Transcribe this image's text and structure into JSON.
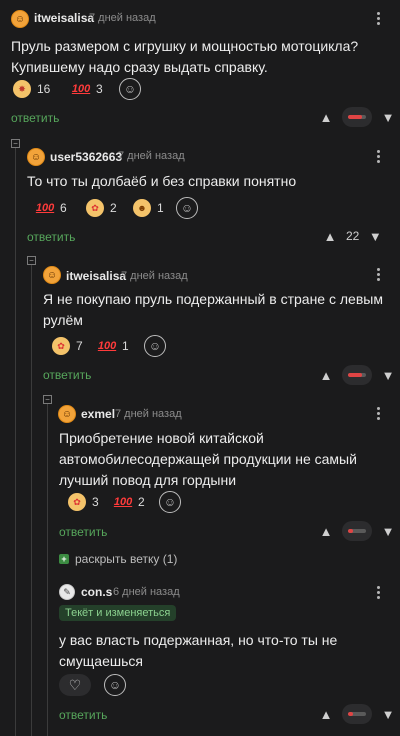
{
  "comments": [
    {
      "username": "itweisalisa",
      "time": "7 дней назад",
      "text": "Пруль размером с игрушку и мощностью мотоцикла? Купившему надо сразу выдать справку.",
      "reactions": [
        {
          "icon": "exploding-face-icon",
          "count": "16"
        },
        {
          "icon": "hundred-icon",
          "count": "3"
        }
      ],
      "reply_label": "ответить",
      "vote_ratio": 0.75
    },
    {
      "username": "user5362663",
      "time": "7 дней назад",
      "text": "То что ты долбаёб и без справки понятно",
      "reactions": [
        {
          "icon": "hundred-icon",
          "count": "6"
        },
        {
          "icon": "clown-face-icon",
          "count": "2"
        },
        {
          "icon": "smiling-face-icon",
          "count": "1"
        }
      ],
      "reply_label": "ответить",
      "vote_count": "22"
    },
    {
      "username": "itweisalisa",
      "time": "7 дней назад",
      "text": "Я не покупаю пруль подержанный в стране с левым рулём",
      "reactions": [
        {
          "icon": "clown-face-icon",
          "count": "7"
        },
        {
          "icon": "hundred-icon",
          "count": "1"
        }
      ],
      "reply_label": "ответить",
      "vote_ratio": 0.75
    },
    {
      "username": "exmel",
      "time": "7 дней назад",
      "text": "Приобретение новой китайской автомобилесодержащей продукции не самый лучший повод для гордыни",
      "reactions": [
        {
          "icon": "clown-face-icon",
          "count": "3"
        },
        {
          "icon": "hundred-icon",
          "count": "2"
        }
      ],
      "reply_label": "ответить",
      "vote_ratio": 0.3
    },
    {
      "username": "con.s",
      "time": "6 дней назад",
      "badge": "Текёт и изменяеться",
      "text": "у вас власть подержанная, но что-то ты не смущаешься",
      "reply_label": "ответить",
      "vote_ratio": 0.3
    }
  ],
  "expand_thread_label": "раскрыть ветку (1)",
  "colors": {
    "accent_green": "#57a75c",
    "downvote_red": "#e04444",
    "background": "#1b1b1c"
  }
}
